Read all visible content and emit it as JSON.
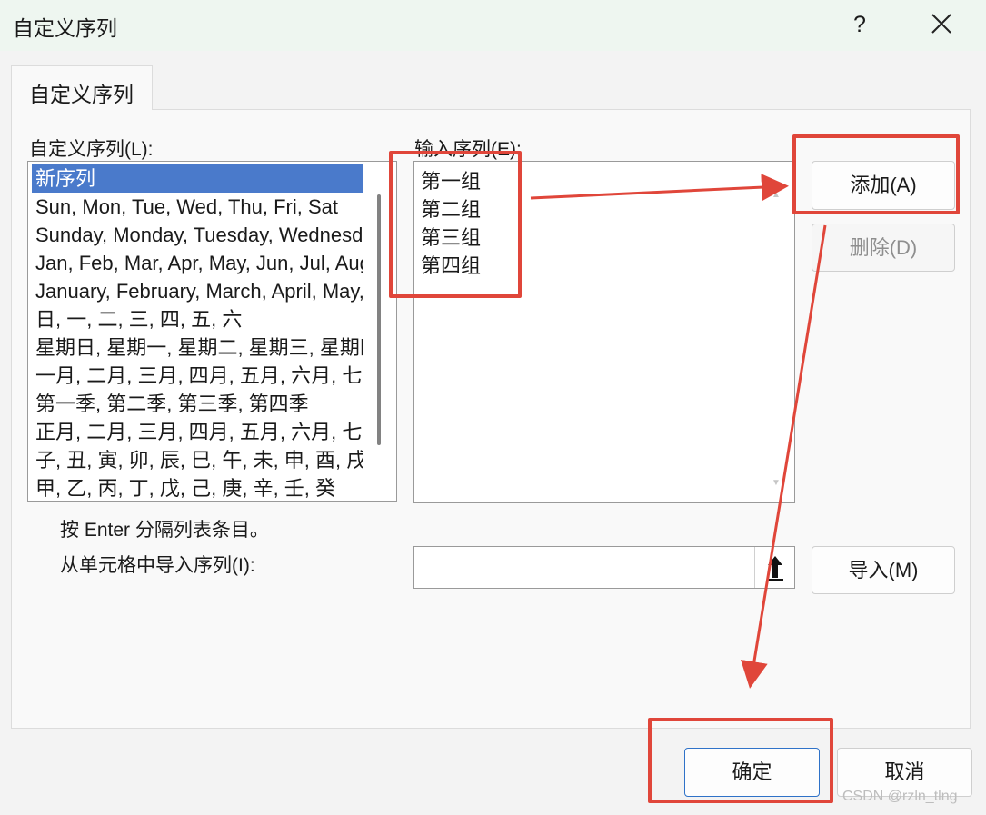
{
  "window": {
    "title": "自定义序列",
    "help_label": "?",
    "close_icon": "close-icon"
  },
  "tabs": [
    {
      "label": "自定义序列",
      "active": true
    }
  ],
  "custom_lists": {
    "label": "自定义序列(L):",
    "items": [
      "新序列",
      "Sun, Mon, Tue, Wed, Thu, Fri, Sat",
      "Sunday, Monday, Tuesday, Wednesday, Thursday, Friday, Saturday",
      "Jan, Feb, Mar, Apr, May, Jun, Jul, Aug, Sep, Oct, Nov, Dec",
      "January, February, March, April, May, June, July, August, September, October, November, December",
      "日, 一, 二, 三, 四, 五, 六",
      "星期日, 星期一, 星期二, 星期三, 星期四, 星期五, 星期六",
      "一月, 二月, 三月, 四月, 五月, 六月, 七月, 八月, 九月, 十月, 十一月, 十二月",
      "第一季, 第二季, 第三季, 第四季",
      "正月, 二月, 三月, 四月, 五月, 六月, 七月, 八月, 九月, 十月, 冬月, 腊月",
      "子, 丑, 寅, 卯, 辰, 巳, 午, 未, 申, 酉, 戌, 亥",
      "甲, 乙, 丙, 丁, 戊, 己, 庚, 辛, 壬, 癸"
    ],
    "selected_index": 0
  },
  "entries": {
    "label": "输入序列(E):",
    "lines": [
      "第一组",
      "第二组",
      "第三组",
      "第四组"
    ]
  },
  "buttons": {
    "add": "添加(A)",
    "delete": "删除(D)",
    "import": "导入(M)",
    "ok": "确定",
    "cancel": "取消"
  },
  "hint": "按 Enter 分隔列表条目。",
  "import_from_cells": {
    "label": "从单元格中导入序列(I):",
    "value": ""
  },
  "annotation_color": "#e0463a",
  "watermark": "CSDN @rzln_tlng"
}
